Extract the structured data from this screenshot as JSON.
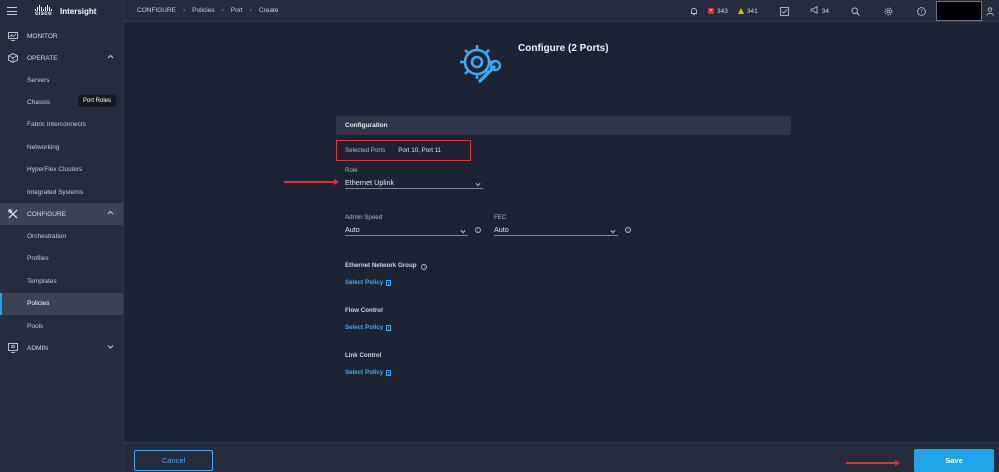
{
  "app": {
    "brand": "Intersight",
    "logo_text": "cisco"
  },
  "sidebar": {
    "sections": [
      {
        "label": "MONITOR",
        "icon": "monitor-icon"
      },
      {
        "label": "OPERATE",
        "icon": "operate-icon",
        "items": [
          {
            "label": "Servers"
          },
          {
            "label": "Chassis"
          },
          {
            "label": "Fabric Interconnects"
          },
          {
            "label": "Networking"
          },
          {
            "label": "HyperFlex Clusters"
          },
          {
            "label": "Integrated Systems"
          }
        ]
      },
      {
        "label": "CONFIGURE",
        "icon": "configure-icon",
        "items": [
          {
            "label": "Orchestration"
          },
          {
            "label": "Profiles"
          },
          {
            "label": "Templates"
          },
          {
            "label": "Policies",
            "selected": true
          },
          {
            "label": "Pools"
          }
        ]
      },
      {
        "label": "ADMIN",
        "icon": "admin-icon"
      }
    ],
    "tooltip": "Port Roles"
  },
  "header": {
    "breadcrumb": [
      "CONFIGURE",
      "Policies",
      "Port",
      "Create"
    ],
    "alarms_critical": "343",
    "alarms_warning": "341",
    "notifications": "34"
  },
  "main": {
    "title": "Configure (2 Ports)",
    "section_title": "Configuration",
    "selected_ports_label": "Selected Ports",
    "selected_ports_value": "Port 10, Port 11",
    "role_label": "Role",
    "role_value": "Ethernet Uplink",
    "admin_speed_label": "Admin Speed",
    "admin_speed_value": "Auto",
    "fec_label": "FEC",
    "fec_value": "Auto",
    "eth_network_group_label": "Ethernet Network Group",
    "flow_control_label": "Flow Control",
    "link_control_label": "Link Control",
    "select_policy_label": "Select Policy"
  },
  "footer": {
    "cancel_label": "Cancel",
    "save_label": "Save"
  },
  "colors": {
    "accent": "#1fa4e8",
    "highlight": "#e0322e",
    "background": "#1c2333"
  }
}
